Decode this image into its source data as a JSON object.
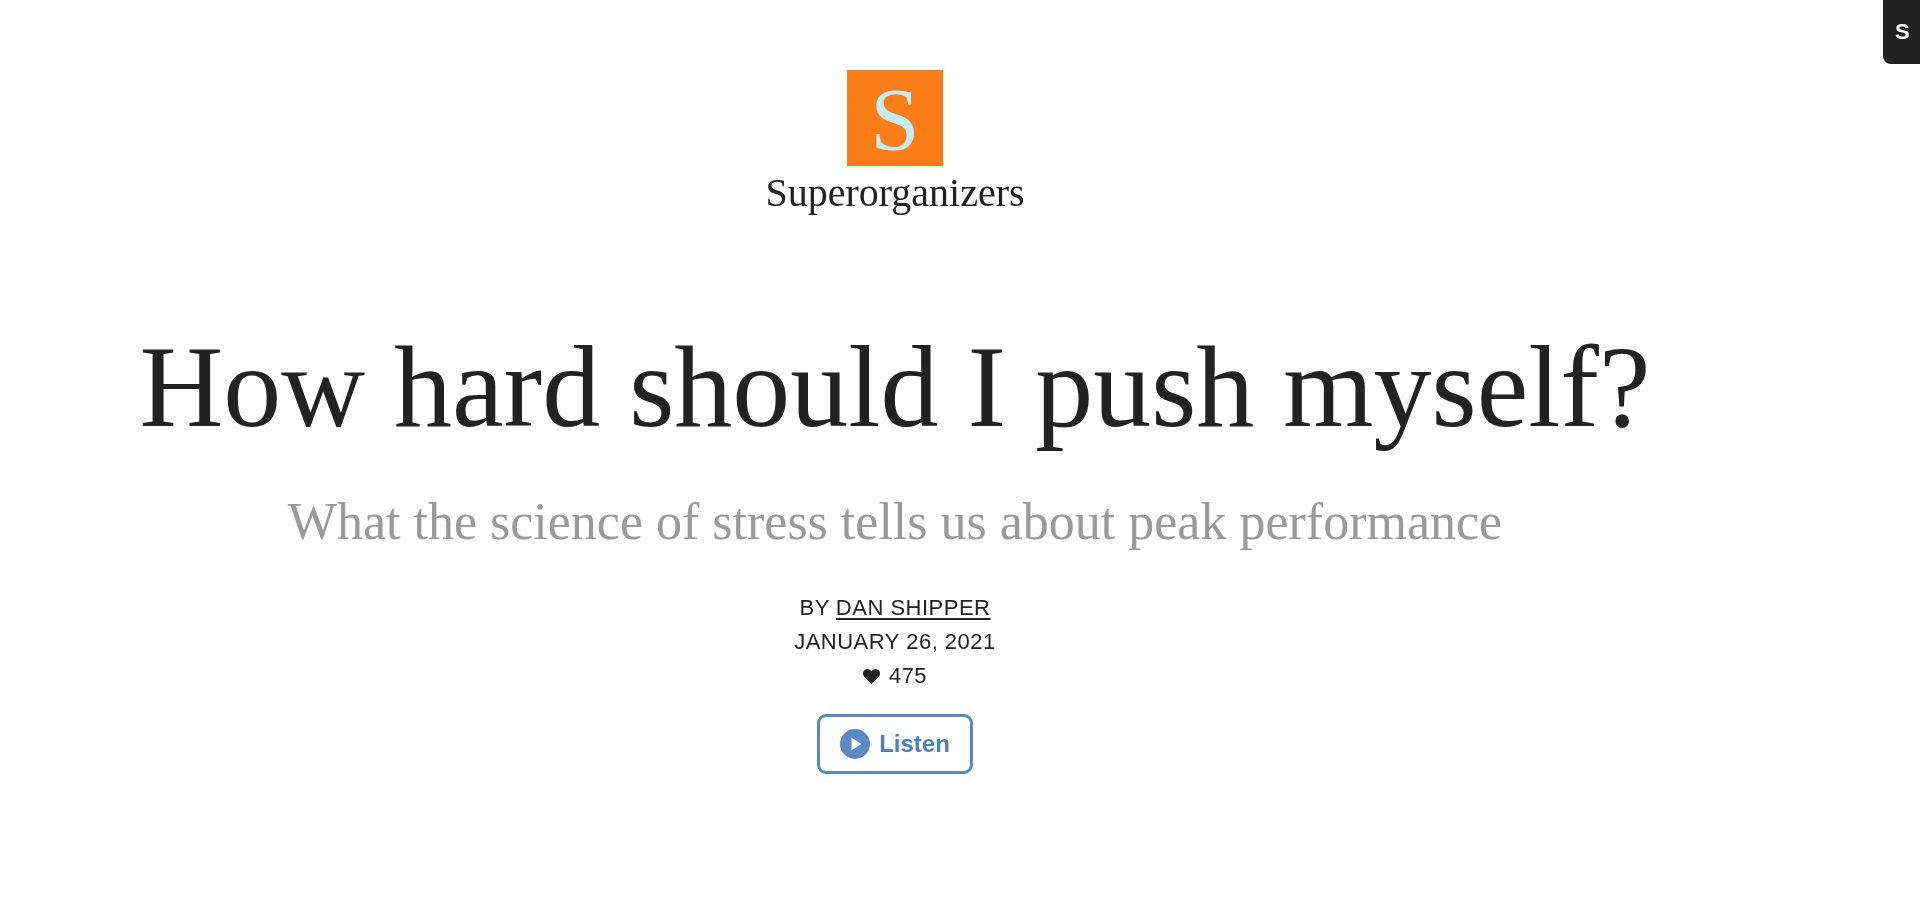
{
  "publication": {
    "logo_letter": "S",
    "name": "Superorganizers"
  },
  "corner_button": {
    "label": "S"
  },
  "article": {
    "title": "How hard should I push myself?",
    "subtitle": "What the science of stress tells us about peak performance",
    "byline_prefix": "BY",
    "author": "DAN SHIPPER",
    "date": "JANUARY 26, 2021",
    "likes": "475",
    "listen_label": "Listen"
  }
}
